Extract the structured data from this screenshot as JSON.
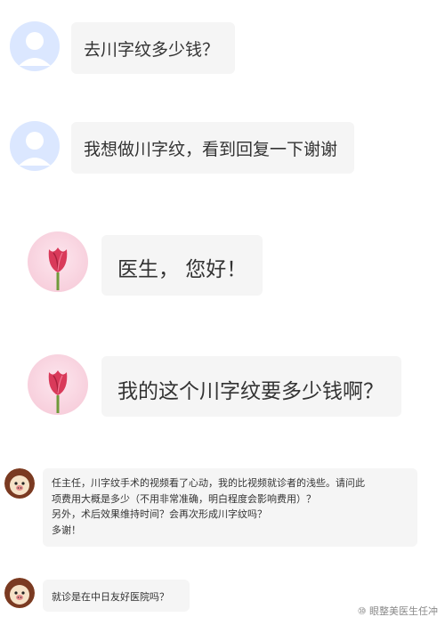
{
  "messages": [
    {
      "text": "去川字纹多少钱？"
    },
    {
      "text": "我想做川字纹，看到回复一下谢谢"
    },
    {
      "text": "医生，  您好！"
    },
    {
      "text": "我的这个川字纹要多少钱啊？"
    },
    {
      "lines": [
        "任主任，川字纹手术的视频看了心动，我的比视频就诊者的浅些。请问此",
        "项费用大概是多少（不用非常准确，明白程度会影响费用）？",
        "另外，术后效果维持时间？会再次形成川字纹吗？",
        "多谢！"
      ]
    },
    {
      "text": "就诊是在中日友好医院吗？"
    }
  ],
  "watermark": "⑩ 眼整美医生任冲",
  "icons": {
    "user": "default-user-avatar-icon",
    "tulip": "tulip-avatar-icon",
    "dog": "cartoon-dog-avatar-icon"
  },
  "colors": {
    "bubble": "#f5f5f5",
    "user_avatar_bg": "#dbe7ff",
    "user_avatar_fg": "#b7cdf8",
    "tulip_avatar_bg": "#f7d3de"
  }
}
